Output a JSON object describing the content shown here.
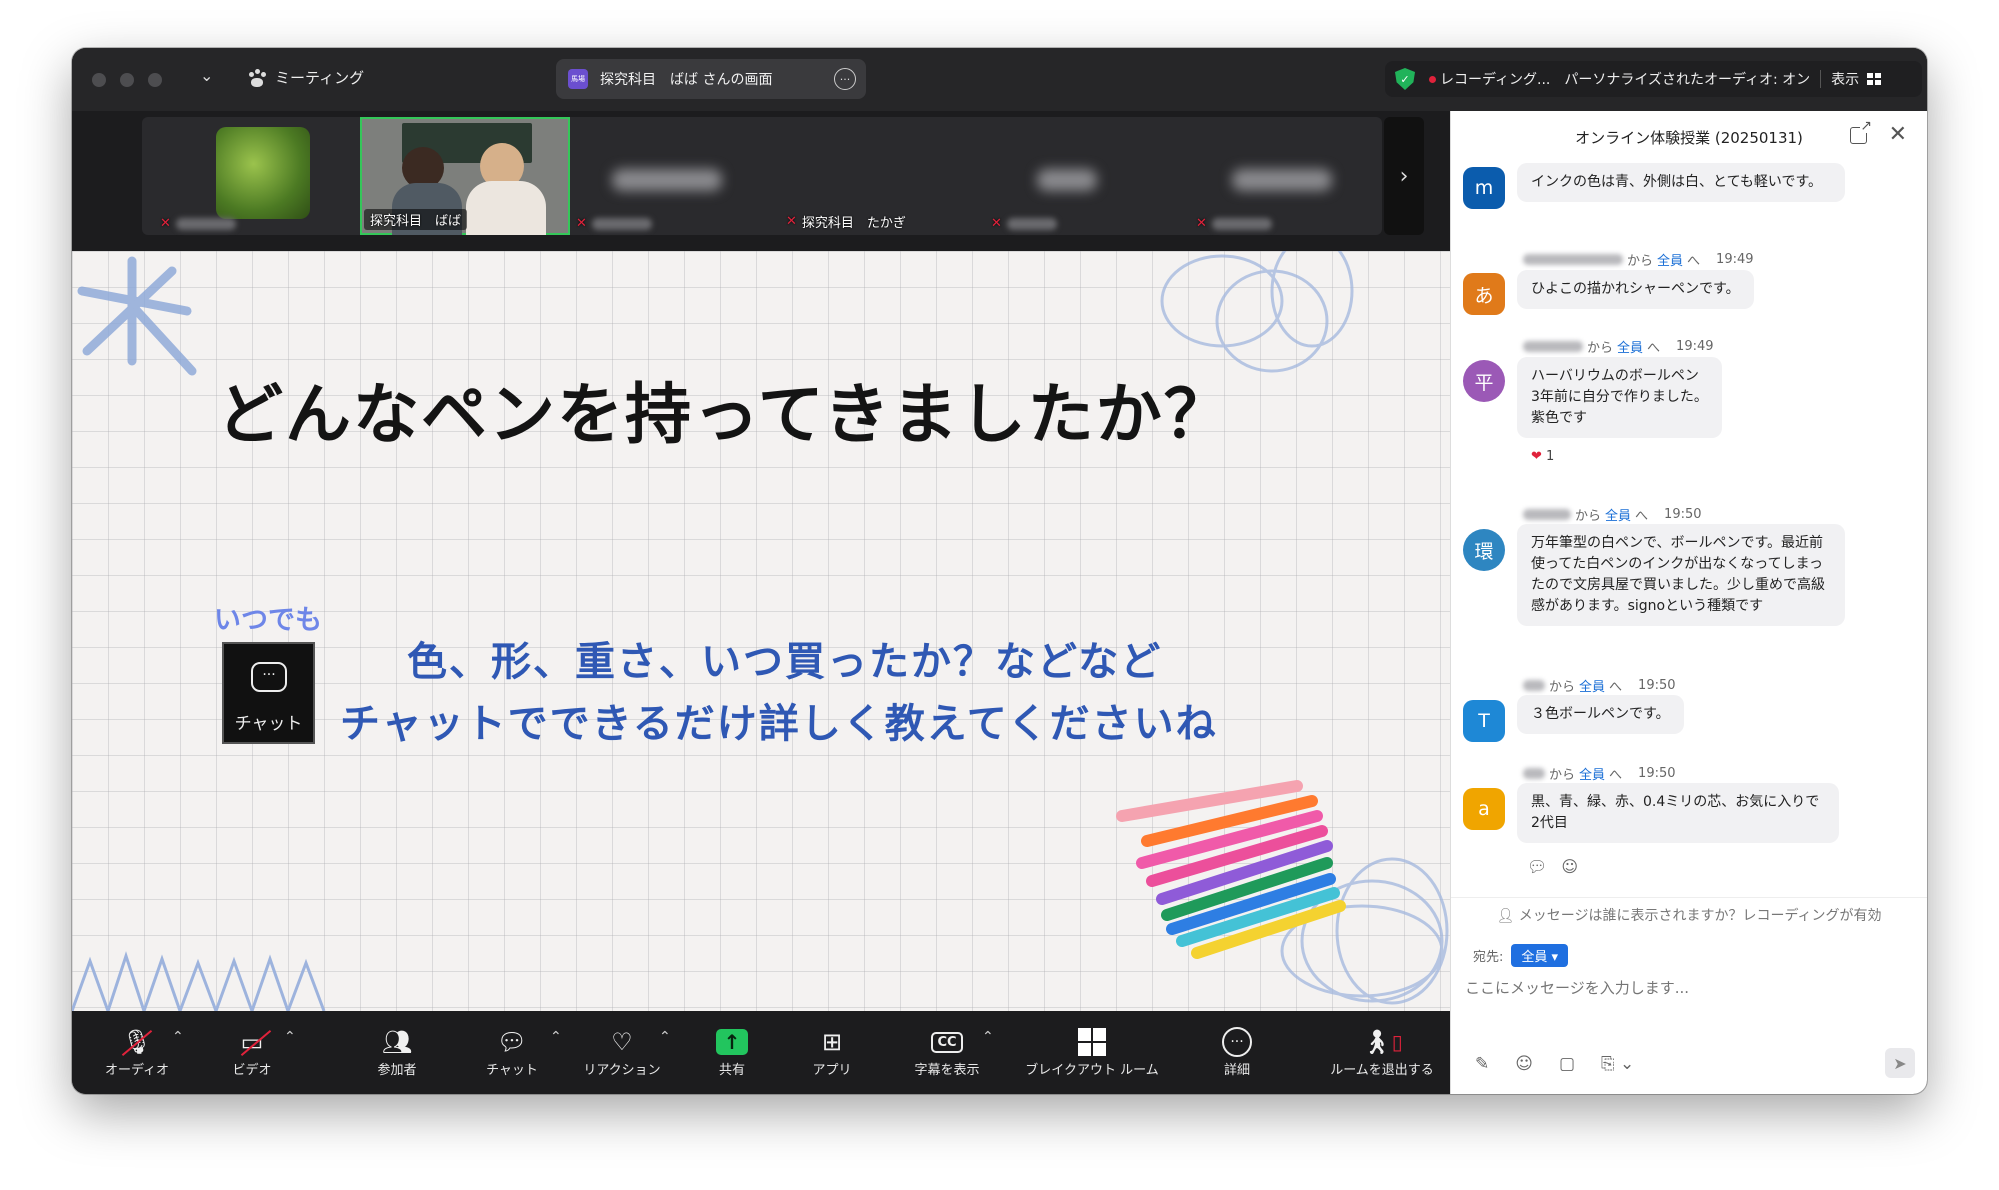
{
  "titlebar": {
    "meeting_label": "ミーティング",
    "share_badge": "馬場",
    "share_text": "探究科目　ばば さんの画面",
    "recording_text": "レコーディング...",
    "audio_text": "パーソナライズされたオーディオ: オン",
    "view_label": "表示"
  },
  "strip": {
    "tile_active_name": "探究科目　ばば",
    "tile_takagi_name": "探究科目　たかぎ"
  },
  "slide": {
    "title": "どんなペンを持ってきましたか？",
    "itsudemo": "いつでも",
    "chat_label": "チャット",
    "line1": "色、形、重さ、いつ買ったか？などなど",
    "line2": "チャットでできるだけ詳しく教えてくださいね"
  },
  "toolbar": {
    "audio": "オーディオ",
    "video": "ビデオ",
    "participants": "参加者",
    "chat": "チャット",
    "reaction": "リアクション",
    "share": "共有",
    "apps": "アプリ",
    "captions": "字幕を表示",
    "breakout": "ブレイクアウト ルーム",
    "more": "詳細",
    "leave": "ルームを退出する"
  },
  "chat_panel": {
    "title": "オンライン体験授業 (20250131)",
    "messages": [
      {
        "avatar": "m",
        "color": "#0b5cad",
        "meta_from": "",
        "meta_to": "",
        "time": "",
        "text": "インクの色は青、外側は白、とても軽いです。"
      },
      {
        "avatar": "あ",
        "color": "#e07a1a",
        "meta_from": "から",
        "meta_to": "全員",
        "time": "19:49",
        "text": "ひよこの描かれシャーペンです。"
      },
      {
        "avatar": "平",
        "color": "#9b59b6",
        "meta_from": "から",
        "meta_to": "全員",
        "time": "19:49",
        "text": "ハーバリウムのボールペン\n3年前に自分で作りました。\n紫色です"
      },
      {
        "avatar": "環",
        "color": "#2e86c1",
        "meta_from": "から",
        "meta_to": "全員",
        "time": "19:50",
        "text": "万年筆型の白ペンで、ボールペンです。最近前使ってた白ペンのインクが出なくなってしまったので文房具屋で買いました。少し重めで高級感があります。signoという種類です"
      },
      {
        "avatar": "T",
        "color": "#1e88d6",
        "meta_from": "から",
        "meta_to": "全員",
        "time": "19:50",
        "text": "３色ボールペンです。"
      },
      {
        "avatar": "a",
        "color": "#f0a500",
        "meta_from": "から",
        "meta_to": "全員",
        "time": "19:50",
        "text": "黒、青、緑、赤、0.4ミリの芯、お気に入りで2代目"
      }
    ],
    "reaction_count": "1",
    "notice": "メッセージは誰に表示されますか？レコーディングが有効",
    "to_label": "宛先:",
    "to_value": "全員",
    "compose_placeholder": "ここにメッセージを入力します..."
  },
  "colors": {
    "accent_blue": "#1f6fe0",
    "share_green": "#22c55e",
    "rec_red": "#e0223b",
    "slide_text_blue": "#2f58b4"
  }
}
